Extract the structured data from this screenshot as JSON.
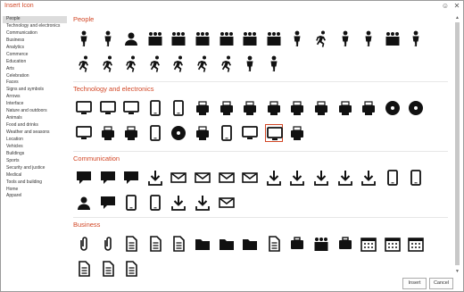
{
  "window": {
    "title": "Insert Icon",
    "smile_icon": "smile-icon",
    "close_icon": "close-icon"
  },
  "sidebar": {
    "selected": "People",
    "items": [
      "People",
      "Technology and electronics",
      "Communication",
      "Business",
      "Analytics",
      "Commerce",
      "Education",
      "Arts",
      "Celebration",
      "Faces",
      "Signs and symbols",
      "Arrows",
      "Interface",
      "Nature and outdoors",
      "Animals",
      "Food and drinks",
      "Weather and seasons",
      "Location",
      "Vehicles",
      "Buildings",
      "Sports",
      "Security and justice",
      "Medical",
      "Tools and building",
      "Home",
      "Apparel"
    ]
  },
  "sections": [
    {
      "title": "People",
      "icons": [
        "man-icon",
        "woman-icon",
        "user-icon",
        "family-icon",
        "group-icon",
        "crowd-icon",
        "couple-icon",
        "couple-icon",
        "family-kids-icon",
        "parent-child-icon",
        "parent-stroller-icon",
        "man-with-briefcase-icon",
        "parent-baby-icon",
        "family-group-icon",
        "baby-icon",
        "baby-crawling-icon",
        "baby-changing-icon",
        "crawling-man-icon",
        "running-man-icon",
        "running-fast-icon",
        "elderly-with-cane-icon",
        "wheelchair-icon",
        "presenter-icon",
        "teacher-at-board-icon"
      ]
    },
    {
      "title": "Technology and electronics",
      "selected_icon": "presentation-screen-icon",
      "icons": [
        "desktop-computer-icon",
        "laptop-icon",
        "monitor-icon",
        "smartphone-icon",
        "tablet-icon",
        "printer-icon",
        "fax-machine-icon",
        "keyboard-icon",
        "server-rack-icon",
        "scanner-icon",
        "router-icon",
        "radio-icon",
        "disk-drive-icon",
        "cd-disc-icon",
        "camera-icon",
        "webcam-icon",
        "game-controller-icon",
        "plug-icon",
        "headphones-icon",
        "vinyl-record-icon",
        "speakers-icon",
        "remote-control-icon",
        "television-icon",
        "presentation-screen-icon",
        "projector-icon"
      ]
    },
    {
      "title": "Communication",
      "icons": [
        "comment-icon",
        "chat-bubble-icon",
        "thought-bubble-icon",
        "network-hub-icon",
        "envelope-icon",
        "open-envelope-icon",
        "mail-icon",
        "inbox-icon",
        "download-icon",
        "cloud-sync-icon",
        "link-icon",
        "paper-plane-icon",
        "share-icon",
        "phone-icon",
        "telephone-icon",
        "headset-person-icon",
        "pin-comment-icon",
        "microphone-icon",
        "megaphone-icon",
        "satellite-dish-icon",
        "satellite-icon",
        "newspaper-icon"
      ]
    },
    {
      "title": "Business",
      "icons": [
        "paperclip-icon",
        "stapler-icon",
        "document-icon",
        "document-text-icon",
        "clipboard-icon",
        "folder-icon",
        "open-folder-icon",
        "briefcase-icon",
        "id-card-icon",
        "org-chart-icon",
        "team-meeting-icon",
        "handshake-icon",
        "calendar-icon",
        "calendar-grid-icon",
        "calendar-month-icon",
        "checklist-icon",
        "report-icon",
        "list-document-icon"
      ]
    }
  ],
  "buttons": {
    "insert": "Insert",
    "cancel": "Cancel"
  }
}
